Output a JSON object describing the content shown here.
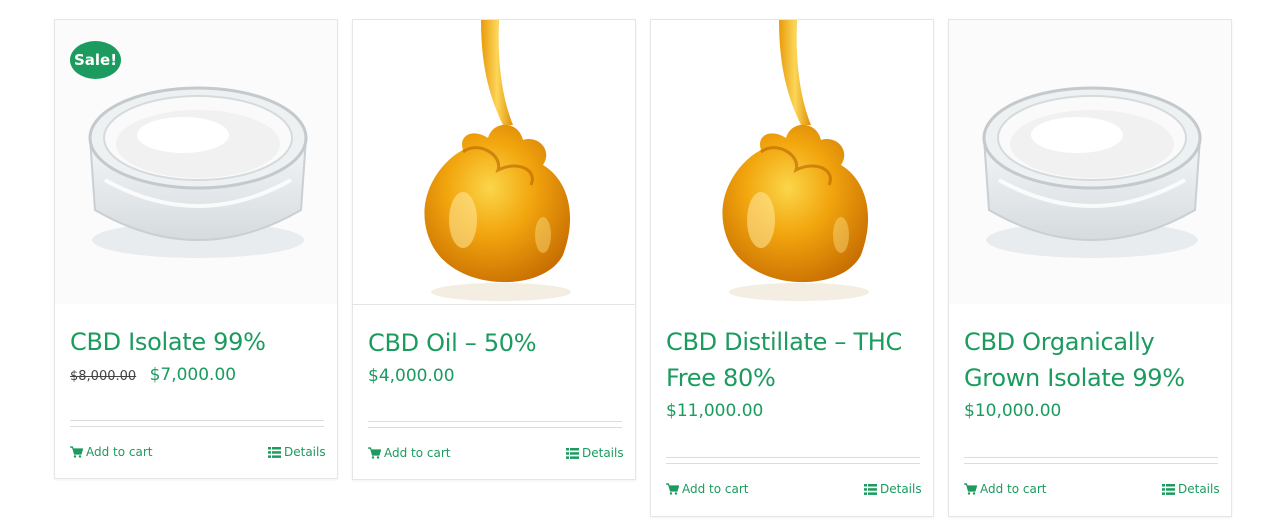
{
  "products": [
    {
      "title": "CBD Isolate 99%",
      "sale_badge": "Sale!",
      "old_price": "$8,000.00",
      "price": "$7,000.00",
      "image": "isolate-jar-image",
      "add_to_cart": "Add to cart",
      "details": "Details"
    },
    {
      "title": "CBD Oil – 50%",
      "price": "$4,000.00",
      "image": "oil-drop-image",
      "add_to_cart": "Add to cart",
      "details": "Details"
    },
    {
      "title": "CBD Distillate – THC Free 80%",
      "price": "$11,000.00",
      "image": "oil-drop-image",
      "add_to_cart": "Add to cart",
      "details": "Details"
    },
    {
      "title": "CBD Organically Grown Isolate 99%",
      "price": "$10,000.00",
      "image": "isolate-jar-image",
      "add_to_cart": "Add to cart",
      "details": "Details"
    }
  ],
  "icons": {
    "cart": "cart-icon",
    "details": "list-icon"
  },
  "colors": {
    "accent": "#1c9b5f",
    "badge": "#1c9b5f",
    "oil": "#f0a20c"
  }
}
